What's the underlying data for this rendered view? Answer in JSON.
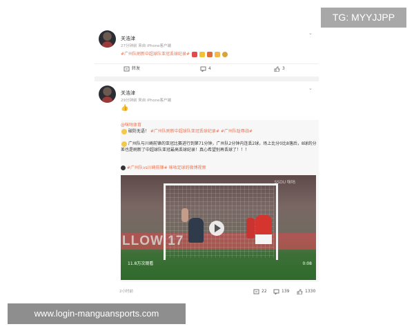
{
  "badges": {
    "tg": "TG: MYYJJPP",
    "site": "www.login-manguansports.com"
  },
  "post1": {
    "username": "关浩津",
    "meta": "27分钟前  来自 iPhone客户端",
    "topic": "#广州队刷新中超球队亚冠丢球纪录#",
    "actions": {
      "repost": "转发",
      "comment": "4",
      "like": "3"
    }
  },
  "post2": {
    "username": "关浩津",
    "meta": "29分钟前  来自 iPhone客户端",
    "emoji": "👍",
    "repost": {
      "author": "@咪咕体育",
      "line1_prefix": "破防无语！",
      "line1_topics": "#广州队刷新中超球队亚冠丢球纪录# #广州队耻辱战#",
      "body": "广州队与川崎前锋的亚冠比赛进行到第71分钟，广州队2分钟内连丢2球，场上比分0比8落后，8球的分差也是刷新了中超球队亚冠最高丢球纪录！真心希望别再丢球了！！！",
      "video_topic": "#广州队vs川崎前锋# 咪咕足球的微博视频",
      "video": {
        "views": "11.8万次观看",
        "duration": "0:08",
        "board_text": "LLOW 17",
        "logo": "SSDU 咪咕"
      }
    },
    "time": "2小时前",
    "actions": {
      "repost": "22",
      "comment": "139",
      "like": "1330"
    }
  },
  "colors": {
    "accent": "#eb7350",
    "muted": "#999999"
  }
}
